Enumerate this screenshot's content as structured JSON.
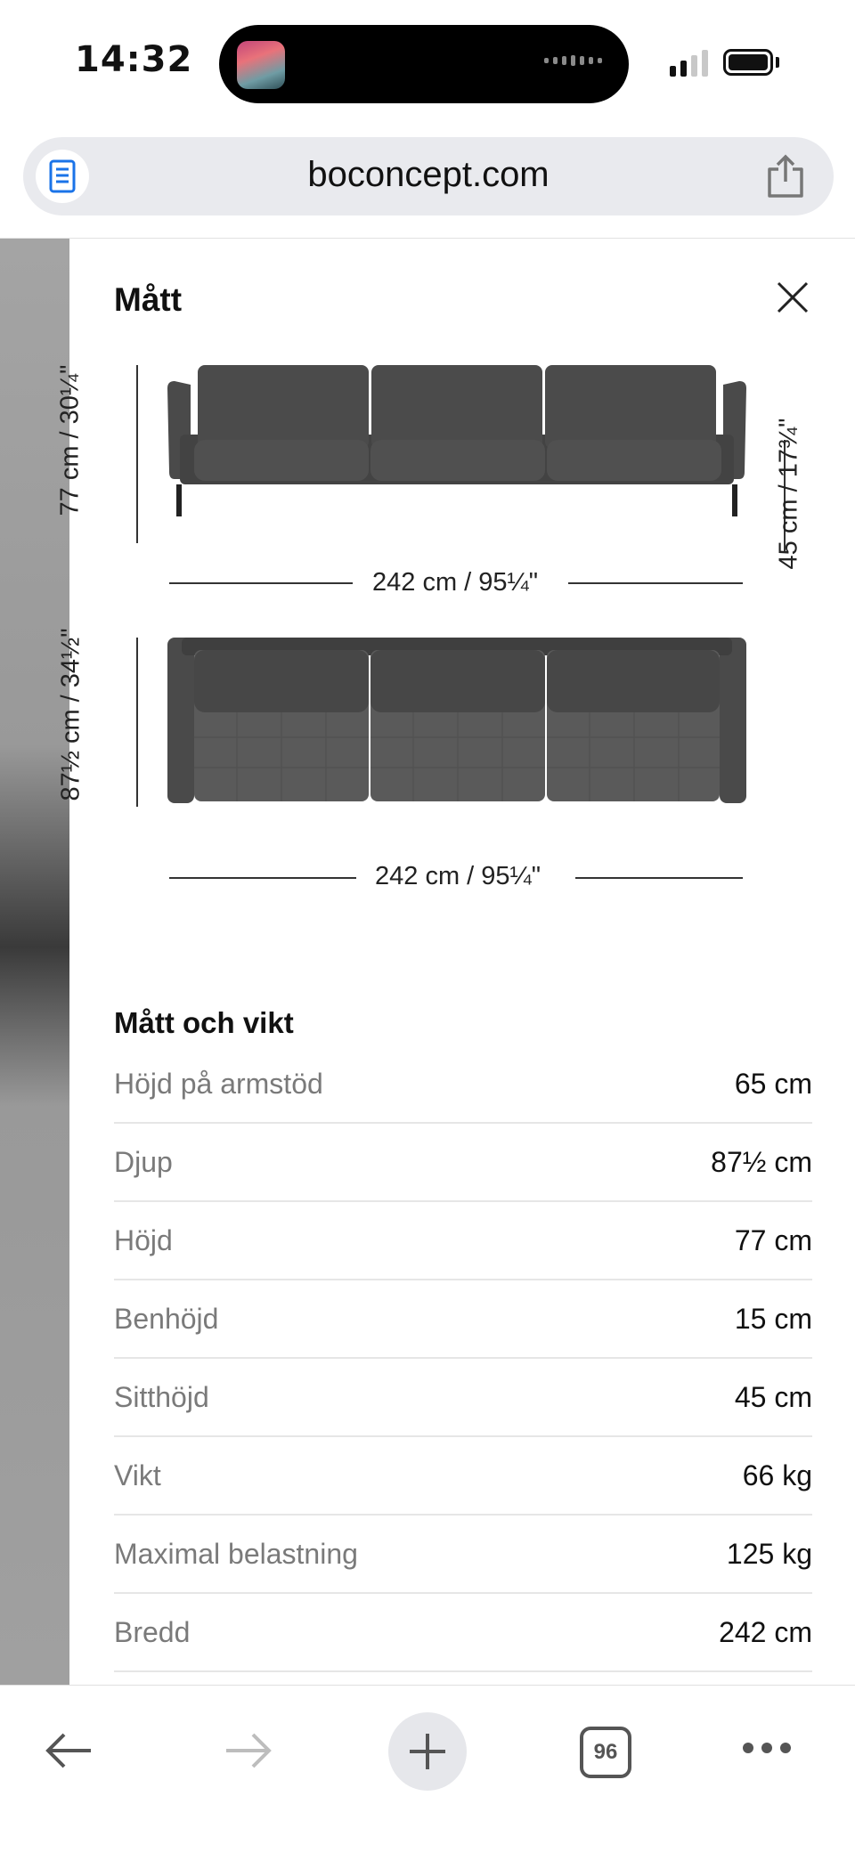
{
  "status_bar": {
    "time": "14:32"
  },
  "browser": {
    "url": "boconcept.com"
  },
  "modal": {
    "title": "Mått",
    "front_view": {
      "height_label": "77 cm / 30¼\"",
      "seat_height_label": "45 cm / 17¾\"",
      "width_label": "242 cm / 95¼\""
    },
    "top_view": {
      "depth_label": "87½ cm / 34½\"",
      "width_label": "242 cm / 95¼\""
    },
    "specs_title": "Mått och vikt",
    "specs": [
      {
        "label": "Höjd på armstöd",
        "value": "65 cm"
      },
      {
        "label": "Djup",
        "value": "87½ cm"
      },
      {
        "label": "Höjd",
        "value": "77 cm"
      },
      {
        "label": "Benhöjd",
        "value": "15 cm"
      },
      {
        "label": "Sitthöjd",
        "value": "45 cm"
      },
      {
        "label": "Vikt",
        "value": "66 kg"
      },
      {
        "label": "Maximal belastning",
        "value": "125 kg"
      },
      {
        "label": "Bredd",
        "value": "242 cm"
      }
    ]
  },
  "toolbar": {
    "tab_count": "96"
  }
}
